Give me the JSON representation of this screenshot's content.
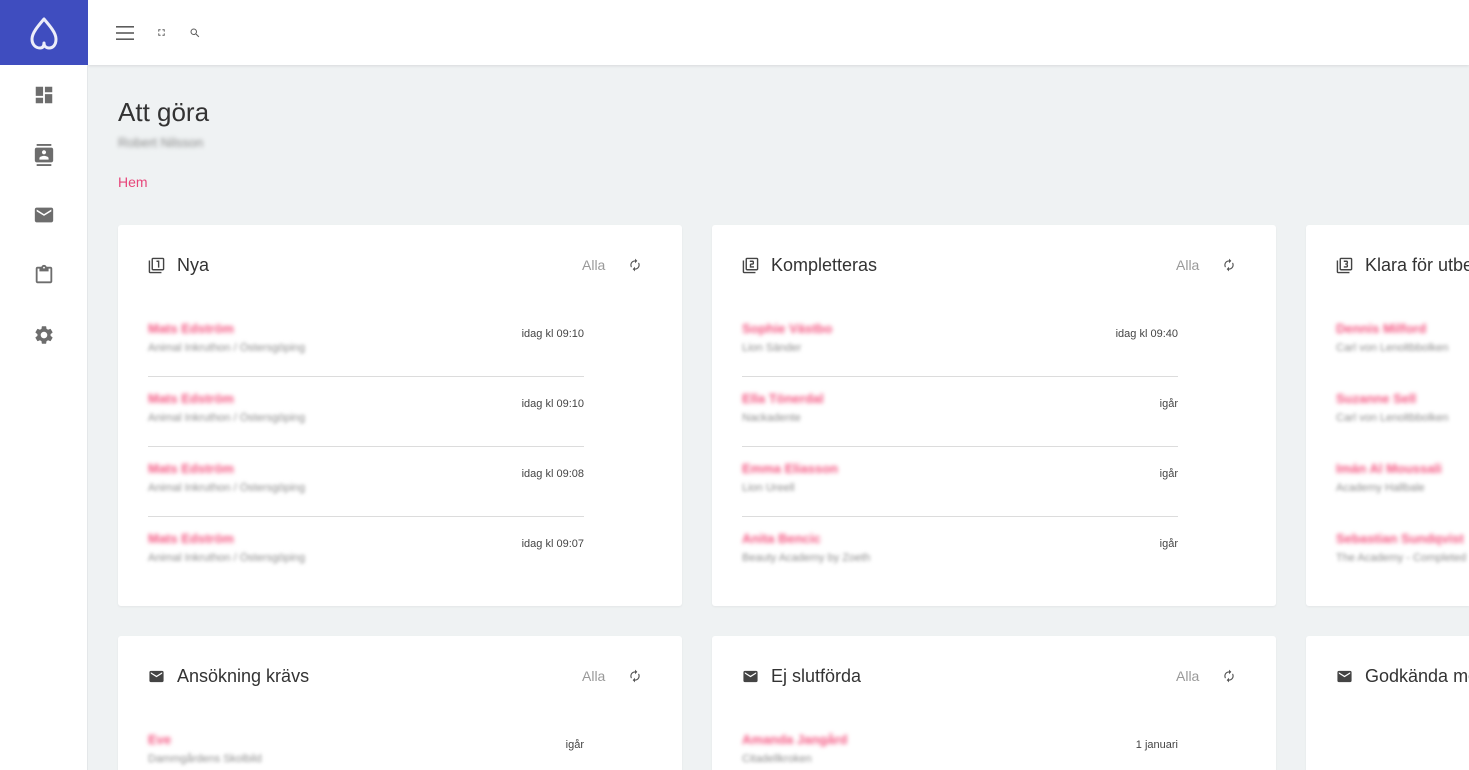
{
  "nav": {
    "items": [
      {
        "icon": "dashboard-icon"
      },
      {
        "icon": "contacts-icon"
      },
      {
        "icon": "mail-icon"
      },
      {
        "icon": "clipboard-icon"
      },
      {
        "icon": "settings-icon"
      }
    ]
  },
  "toolbar": {
    "icons": [
      "menu-icon",
      "fullscreen-icon",
      "search-icon"
    ]
  },
  "page": {
    "title": "Att göra",
    "subtitle": "Robert Nilsson",
    "breadcrumb": "Hem"
  },
  "cards": [
    {
      "title": "Nya",
      "icon": "filter-1-icon",
      "all_label": "Alla",
      "rows": [
        {
          "name": "Mats Edström",
          "org": "Animal Inkruthon / Östersgöping",
          "time": "idag kl 09:10"
        },
        {
          "name": "Mats Edström",
          "org": "Animal Inkruthon / Östersgöping",
          "time": "idag kl 09:10"
        },
        {
          "name": "Mats Edström",
          "org": "Animal Inkruthon / Östersgöping",
          "time": "idag kl 09:08"
        },
        {
          "name": "Mats Edström",
          "org": "Animal Inkruthon / Östersgöping",
          "time": "idag kl 09:07"
        }
      ]
    },
    {
      "title": "Kompletteras",
      "icon": "filter-2-icon",
      "all_label": "Alla",
      "rows": [
        {
          "name": "Sophie Västbo",
          "org": "Lion Sänder",
          "time": "idag kl 09:40"
        },
        {
          "name": "Ella Tönerdal",
          "org": "Nackadente",
          "time": "igår"
        },
        {
          "name": "Emma Eliasson",
          "org": "Lion Ureell",
          "time": "igår"
        },
        {
          "name": "Anita Bencic",
          "org": "Beauty Academy by Zoeth",
          "time": "igår"
        }
      ]
    },
    {
      "title": "Klara för utbe",
      "icon": "filter-3-icon",
      "all_label": "",
      "rows": [
        {
          "name": "Dennis Milford",
          "org": "Carl von Lenoltbbolken",
          "time": ""
        },
        {
          "name": "Suzanne Sell",
          "org": "Carl von Lenoltbbolken",
          "time": ""
        },
        {
          "name": "Imán Al Moussali",
          "org": "Academy Hallbale",
          "time": ""
        },
        {
          "name": "Sebastian Sundqvist",
          "org": "The Academy - Completed",
          "time": ""
        }
      ]
    },
    {
      "title": "Ansökning krävs",
      "icon": "mail-icon",
      "all_label": "Alla",
      "rows": [
        {
          "name": "Eve",
          "org": "Dammgårdens Skolbild",
          "time": "igår"
        }
      ]
    },
    {
      "title": "Ej slutförda",
      "icon": "mail-icon",
      "all_label": "Alla",
      "rows": [
        {
          "name": "Amanda Jangård",
          "org": "Citadellkroken",
          "time": "1 januari"
        }
      ]
    },
    {
      "title": "Godkända me",
      "icon": "mail-icon",
      "all_label": "",
      "rows": []
    }
  ]
}
